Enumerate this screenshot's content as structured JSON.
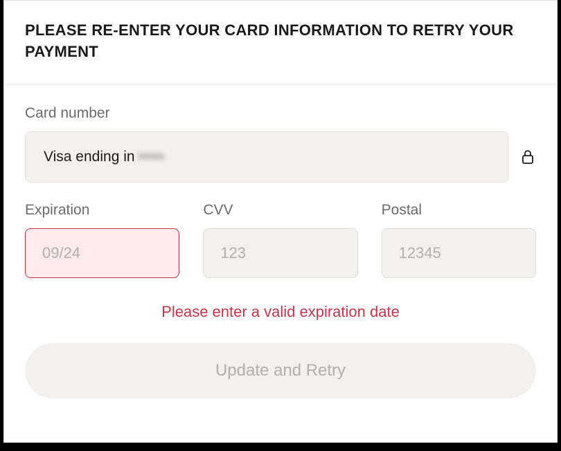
{
  "header": {
    "title": "PLEASE RE-ENTER YOUR CARD INFORMATION TO RETRY YOUR PAYMENT"
  },
  "card_number": {
    "label": "Card number",
    "display_prefix": "Visa ending in ",
    "masked": "••••"
  },
  "expiration": {
    "label": "Expiration",
    "placeholder": "09/24",
    "value": "",
    "has_error": true
  },
  "cvv": {
    "label": "CVV",
    "placeholder": "123",
    "value": ""
  },
  "postal": {
    "label": "Postal",
    "placeholder": "12345",
    "value": ""
  },
  "error_message": "Please enter a valid expiration date",
  "submit": {
    "label": "Update and Retry",
    "disabled": true
  }
}
